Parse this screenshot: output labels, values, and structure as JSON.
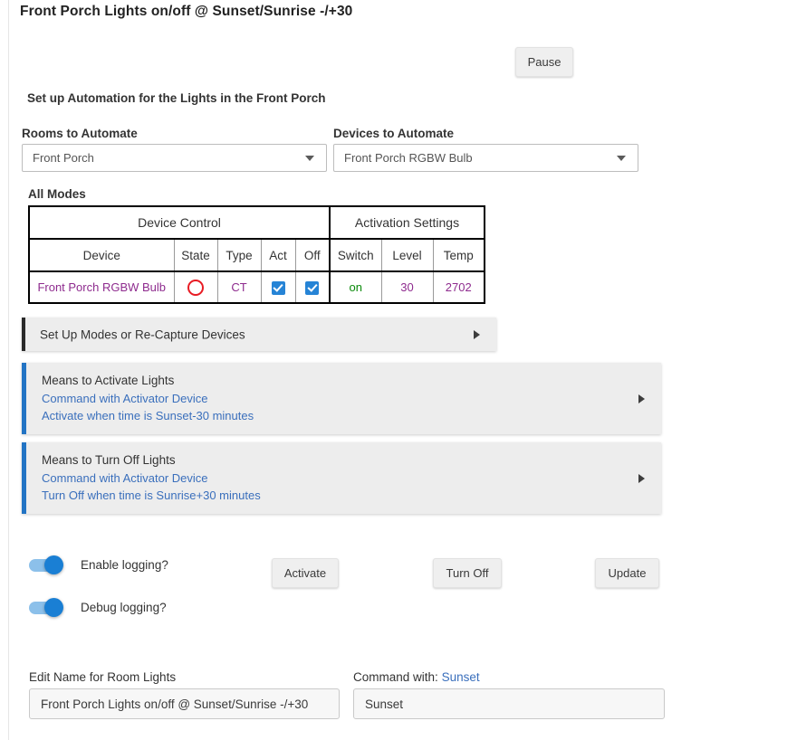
{
  "page": {
    "title": "Front Porch Lights on/off @ Sunset/Sunrise -/+30",
    "subtitle": "Set up Automation for the Lights in the Front Porch"
  },
  "header": {
    "pause_label": "Pause"
  },
  "selects": {
    "rooms": {
      "label": "Rooms to Automate",
      "value": "Front Porch"
    },
    "devices": {
      "label": "Devices to Automate",
      "value": "Front Porch RGBW Bulb"
    }
  },
  "modes_table": {
    "caption": "All Modes",
    "group_headers": [
      "Device Control",
      "Activation Settings"
    ],
    "columns": [
      "Device",
      "State",
      "Type",
      "Act",
      "Off",
      "Switch",
      "Level",
      "Temp"
    ],
    "rows": [
      {
        "device": "Front Porch RGBW Bulb",
        "state_icon": "red-circle-icon",
        "type": "CT",
        "act_checked": true,
        "off_checked": true,
        "switch": "on",
        "level": "30",
        "temp": "2702"
      }
    ],
    "colors": {
      "device_text": "#8e2b8e",
      "state_circle": "#e81c24",
      "switch_on": "#0a8a0a",
      "checkbox": "#2684d6"
    }
  },
  "accordions": [
    {
      "name": "modes-setup",
      "title": "Set Up Modes or Re-Capture Devices",
      "arrow_icon": "triangle-right-icon",
      "accent": "#2a2a2a"
    },
    {
      "name": "activate-means",
      "header": "Means to Activate Lights",
      "line1": "Command with Activator Device",
      "line2": "Activate when time is Sunset-30 minutes",
      "arrow_icon": "triangle-right-icon",
      "accent": "#2374c4"
    },
    {
      "name": "turnoff-means",
      "header": "Means to Turn Off Lights",
      "line1": "Command with Activator Device",
      "line2": "Turn Off when time is Sunrise+30 minutes",
      "arrow_icon": "triangle-right-icon",
      "accent": "#2374c4"
    }
  ],
  "toggles": [
    {
      "label": "Enable logging?",
      "on": true
    },
    {
      "label": "Debug logging?",
      "on": true
    }
  ],
  "buttons": {
    "activate": "Activate",
    "turn_off": "Turn Off",
    "update": "Update"
  },
  "bottom": {
    "name_label": "Edit Name for Room Lights",
    "name_value": "Front Porch Lights on/off @ Sunset/Sunrise -/+30",
    "command_label": "Command with:",
    "command_link": "Sunset",
    "command_value": "Sunset"
  }
}
